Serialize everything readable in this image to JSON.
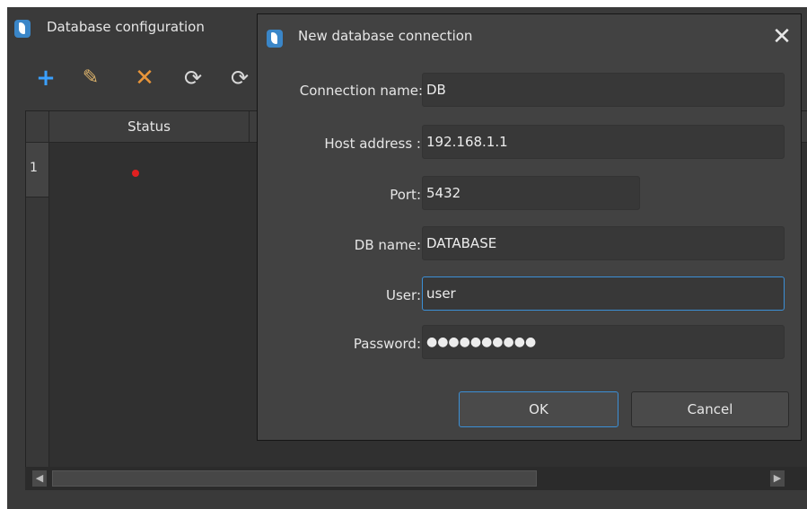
{
  "main_window": {
    "title": "Database configuration",
    "toolbar": {
      "add_icon": "+",
      "edit_icon": "✎",
      "delete_icon": "✕",
      "refresh_icon": "⟳",
      "refresh2_icon": "⟳"
    },
    "table": {
      "columns": [
        "Status"
      ],
      "rows": [
        {
          "number": "1",
          "status": "error"
        }
      ]
    }
  },
  "dialog": {
    "title": "New database connection",
    "close_icon": "✕",
    "fields": {
      "connection_name": {
        "label": "Connection name:",
        "value": "DB"
      },
      "host_address": {
        "label": "Host address :",
        "value": "192.168.1.1"
      },
      "port": {
        "label": "Port:",
        "value": "5432"
      },
      "db_name": {
        "label": "DB name:",
        "value": "DATABASE"
      },
      "user": {
        "label": "User:",
        "value": "user"
      },
      "password": {
        "label": "Password:",
        "value": "●●●●●●●●●●"
      }
    },
    "ok_label": "OK",
    "cancel_label": "Cancel"
  },
  "colors": {
    "accent": "#3b8fd6",
    "status_error": "#e02020",
    "background": "#3a3a3a",
    "dialog_background": "#424242"
  }
}
